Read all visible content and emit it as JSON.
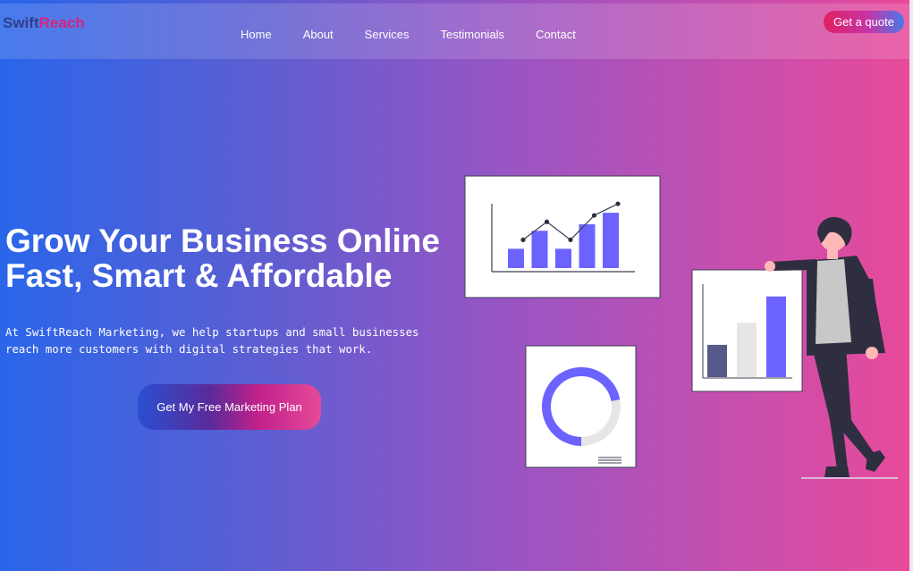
{
  "header": {
    "logo": {
      "part1": "Swift",
      "part2": "Reach"
    },
    "nav": [
      "Home",
      "About",
      "Services",
      "Testimonials",
      "Contact"
    ],
    "quote_button": "Get a quote"
  },
  "hero": {
    "title_line1": "Grow Your Business Online",
    "title_line2": "Fast, Smart & Affordable",
    "sub_line1": "At SwiftReach Marketing, we help startups and small businesses",
    "sub_line2": "reach more customers with digital strategies that work.",
    "cta": "Get My Free Marketing Plan"
  },
  "colors": {
    "bar": "#6c63ff",
    "bar_dark": "#575a89",
    "bar_light": "#e6e6e6",
    "figure_dark": "#2f2e41",
    "skin": "#ffb8b8"
  },
  "illustration": {
    "bar_card": {
      "bars": [
        0.3,
        0.58,
        0.3,
        0.68,
        0.86
      ]
    },
    "donut_card": {
      "fill_fraction": 0.72
    },
    "small_bar_card": {
      "bars": [
        0.38,
        0.64,
        0.95
      ]
    }
  }
}
